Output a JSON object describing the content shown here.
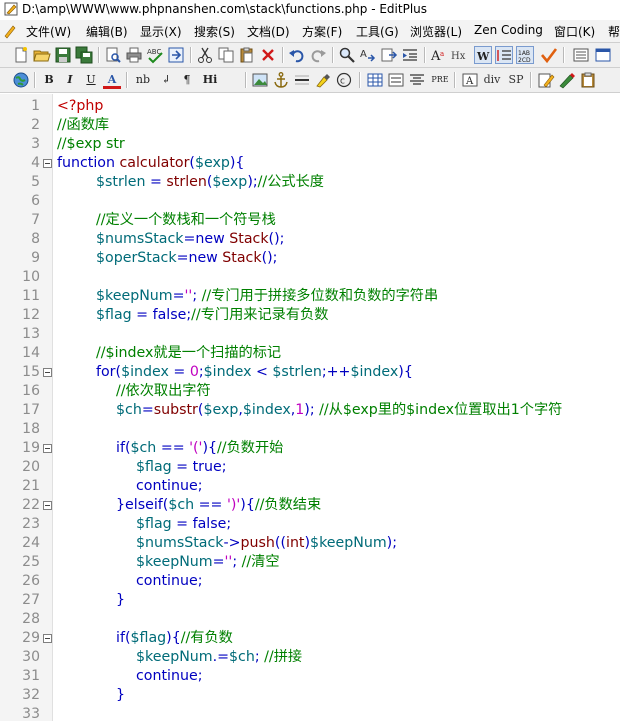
{
  "window": {
    "title": "D:\\amp\\WWW\\www.phpnanshen.com\\stack\\functions.php - EditPlus"
  },
  "menu": [
    {
      "label": "文件(W)"
    },
    {
      "label": "编辑(B)"
    },
    {
      "label": "显示(X)"
    },
    {
      "label": "搜索(S)"
    },
    {
      "label": "文档(D)"
    },
    {
      "label": "方案(F)"
    },
    {
      "label": "工具(G)"
    },
    {
      "label": "浏览器(L)"
    },
    {
      "label": "Zen Coding"
    },
    {
      "label": "窗口(K)"
    },
    {
      "label": "帮"
    }
  ],
  "toolbar1": {
    "icons": [
      "new-file-icon",
      "open-folder-icon",
      "save-icon",
      "save-all-icon",
      "print-preview-icon",
      "print-icon",
      "spell-check-icon",
      "browser-preview-icon",
      "cut-icon",
      "copy-icon",
      "paste-icon",
      "delete-icon",
      "undo-icon",
      "redo-icon",
      "find-icon",
      "replace-icon",
      "goto-icon",
      "indent-icon",
      "font-icon",
      "hex-icon",
      "word-wrap-icon",
      "line-number-icon",
      "column-icon",
      "check-icon",
      "settings-icon",
      "window-icon"
    ]
  },
  "toolbar2": {
    "labels": {
      "bold": "B",
      "italic": "I",
      "underline": "U",
      "font_color": "A",
      "nbsp": "nb",
      "br": "↲",
      "para": "¶",
      "heading": "Hi",
      "pre": "PRE",
      "div": "div",
      "span": "SP"
    },
    "icons": [
      "globe-icon",
      "image-icon",
      "anchor-icon",
      "hr-icon",
      "highlight-icon",
      "copyright-icon",
      "table-icon",
      "form-icon",
      "center-icon",
      "textbox-icon",
      "edit-icon",
      "pen-icon",
      "clipboard-icon"
    ]
  },
  "editor": {
    "lines": [
      {
        "n": "1",
        "indent": 0,
        "fold": false,
        "tokens": [
          {
            "t": "tag",
            "v": "<?php"
          }
        ]
      },
      {
        "n": "2",
        "indent": 0,
        "fold": false,
        "tokens": [
          {
            "t": "com",
            "v": "//函数库"
          }
        ]
      },
      {
        "n": "3",
        "indent": 0,
        "fold": false,
        "tokens": [
          {
            "t": "com",
            "v": "//$exp str"
          }
        ]
      },
      {
        "n": "4",
        "indent": 0,
        "fold": true,
        "tokens": [
          {
            "t": "kw",
            "v": "function "
          },
          {
            "t": "fn",
            "v": "calculator"
          },
          {
            "t": "op",
            "v": "("
          },
          {
            "t": "var",
            "v": "$exp"
          },
          {
            "t": "op",
            "v": "){"
          }
        ]
      },
      {
        "n": "5",
        "indent": 1,
        "fold": false,
        "tokens": [
          {
            "t": "var",
            "v": "$strlen"
          },
          {
            "t": "op",
            "v": " = "
          },
          {
            "t": "fn",
            "v": "strlen"
          },
          {
            "t": "op",
            "v": "("
          },
          {
            "t": "var",
            "v": "$exp"
          },
          {
            "t": "op",
            "v": ");"
          },
          {
            "t": "com",
            "v": "//公式长度"
          }
        ]
      },
      {
        "n": "6",
        "indent": 0,
        "fold": false,
        "tokens": []
      },
      {
        "n": "7",
        "indent": 1,
        "fold": false,
        "tokens": [
          {
            "t": "com",
            "v": "//定义一个数栈和一个符号栈"
          }
        ]
      },
      {
        "n": "8",
        "indent": 1,
        "fold": false,
        "tokens": [
          {
            "t": "var",
            "v": "$numsStack"
          },
          {
            "t": "op",
            "v": "="
          },
          {
            "t": "kw",
            "v": "new "
          },
          {
            "t": "fn",
            "v": "Stack"
          },
          {
            "t": "op",
            "v": "();"
          }
        ]
      },
      {
        "n": "9",
        "indent": 1,
        "fold": false,
        "tokens": [
          {
            "t": "var",
            "v": "$operStack"
          },
          {
            "t": "op",
            "v": "="
          },
          {
            "t": "kw",
            "v": "new "
          },
          {
            "t": "fn",
            "v": "Stack"
          },
          {
            "t": "op",
            "v": "();"
          }
        ]
      },
      {
        "n": "10",
        "indent": 0,
        "fold": false,
        "tokens": []
      },
      {
        "n": "11",
        "indent": 1,
        "fold": false,
        "tokens": [
          {
            "t": "var",
            "v": "$keepNum"
          },
          {
            "t": "op",
            "v": "="
          },
          {
            "t": "str",
            "v": "''"
          },
          {
            "t": "op",
            "v": "; "
          },
          {
            "t": "com",
            "v": "//专门用于拼接多位数和负数的字符串"
          }
        ]
      },
      {
        "n": "12",
        "indent": 1,
        "fold": false,
        "tokens": [
          {
            "t": "var",
            "v": "$flag"
          },
          {
            "t": "op",
            "v": " = "
          },
          {
            "t": "kw",
            "v": "false"
          },
          {
            "t": "op",
            "v": ";"
          },
          {
            "t": "com",
            "v": "//专门用来记录有负数"
          }
        ]
      },
      {
        "n": "13",
        "indent": 0,
        "fold": false,
        "tokens": []
      },
      {
        "n": "14",
        "indent": 1,
        "fold": false,
        "tokens": [
          {
            "t": "com",
            "v": "//$index就是一个扫描的标记"
          }
        ]
      },
      {
        "n": "15",
        "indent": 1,
        "fold": true,
        "tokens": [
          {
            "t": "kw",
            "v": "for"
          },
          {
            "t": "op",
            "v": "("
          },
          {
            "t": "var",
            "v": "$index"
          },
          {
            "t": "op",
            "v": " = "
          },
          {
            "t": "num",
            "v": "0"
          },
          {
            "t": "op",
            "v": ";"
          },
          {
            "t": "var",
            "v": "$index"
          },
          {
            "t": "op",
            "v": " < "
          },
          {
            "t": "var",
            "v": "$strlen"
          },
          {
            "t": "op",
            "v": ";++"
          },
          {
            "t": "var",
            "v": "$index"
          },
          {
            "t": "op",
            "v": "){"
          }
        ]
      },
      {
        "n": "16",
        "indent": 2,
        "fold": false,
        "tokens": [
          {
            "t": "com",
            "v": "//依次取出字符"
          }
        ]
      },
      {
        "n": "17",
        "indent": 2,
        "fold": false,
        "tokens": [
          {
            "t": "var",
            "v": "$ch"
          },
          {
            "t": "op",
            "v": "="
          },
          {
            "t": "fn",
            "v": "substr"
          },
          {
            "t": "op",
            "v": "("
          },
          {
            "t": "var",
            "v": "$exp"
          },
          {
            "t": "op",
            "v": ","
          },
          {
            "t": "var",
            "v": "$index"
          },
          {
            "t": "op",
            "v": ","
          },
          {
            "t": "num",
            "v": "1"
          },
          {
            "t": "op",
            "v": "); "
          },
          {
            "t": "com",
            "v": "//从$exp里的$index位置取出1个字符"
          }
        ]
      },
      {
        "n": "18",
        "indent": 0,
        "fold": false,
        "tokens": []
      },
      {
        "n": "19",
        "indent": 2,
        "fold": true,
        "tokens": [
          {
            "t": "kw",
            "v": "if"
          },
          {
            "t": "op",
            "v": "("
          },
          {
            "t": "var",
            "v": "$ch"
          },
          {
            "t": "op",
            "v": " == "
          },
          {
            "t": "str",
            "v": "'('"
          },
          {
            "t": "op",
            "v": "){"
          },
          {
            "t": "com",
            "v": "//负数开始"
          }
        ]
      },
      {
        "n": "20",
        "indent": 3,
        "fold": false,
        "tokens": [
          {
            "t": "var",
            "v": "$flag"
          },
          {
            "t": "op",
            "v": " = "
          },
          {
            "t": "kw",
            "v": "true"
          },
          {
            "t": "op",
            "v": ";"
          }
        ]
      },
      {
        "n": "21",
        "indent": 3,
        "fold": false,
        "tokens": [
          {
            "t": "kw",
            "v": "continue"
          },
          {
            "t": "op",
            "v": ";"
          }
        ]
      },
      {
        "n": "22",
        "indent": 2,
        "fold": true,
        "tokens": [
          {
            "t": "op",
            "v": "}"
          },
          {
            "t": "kw",
            "v": "elseif"
          },
          {
            "t": "op",
            "v": "("
          },
          {
            "t": "var",
            "v": "$ch"
          },
          {
            "t": "op",
            "v": " == "
          },
          {
            "t": "str",
            "v": "')'"
          },
          {
            "t": "op",
            "v": "){"
          },
          {
            "t": "com",
            "v": "//负数结束"
          }
        ]
      },
      {
        "n": "23",
        "indent": 3,
        "fold": false,
        "tokens": [
          {
            "t": "var",
            "v": "$flag"
          },
          {
            "t": "op",
            "v": " = "
          },
          {
            "t": "kw",
            "v": "false"
          },
          {
            "t": "op",
            "v": ";"
          }
        ]
      },
      {
        "n": "24",
        "indent": 3,
        "fold": false,
        "tokens": [
          {
            "t": "var",
            "v": "$numsStack"
          },
          {
            "t": "op",
            "v": "->"
          },
          {
            "t": "fn",
            "v": "push"
          },
          {
            "t": "op",
            "v": "(("
          },
          {
            "t": "fn",
            "v": "int"
          },
          {
            "t": "op",
            "v": ")"
          },
          {
            "t": "var",
            "v": "$keepNum"
          },
          {
            "t": "op",
            "v": ");"
          }
        ]
      },
      {
        "n": "25",
        "indent": 3,
        "fold": false,
        "tokens": [
          {
            "t": "var",
            "v": "$keepNum"
          },
          {
            "t": "op",
            "v": "="
          },
          {
            "t": "str",
            "v": "''"
          },
          {
            "t": "op",
            "v": "; "
          },
          {
            "t": "com",
            "v": "//清空"
          }
        ]
      },
      {
        "n": "26",
        "indent": 3,
        "fold": false,
        "tokens": [
          {
            "t": "kw",
            "v": "continue"
          },
          {
            "t": "op",
            "v": ";"
          }
        ]
      },
      {
        "n": "27",
        "indent": 2,
        "fold": false,
        "tokens": [
          {
            "t": "op",
            "v": "}"
          }
        ]
      },
      {
        "n": "28",
        "indent": 0,
        "fold": false,
        "tokens": []
      },
      {
        "n": "29",
        "indent": 2,
        "fold": true,
        "tokens": [
          {
            "t": "kw",
            "v": "if"
          },
          {
            "t": "op",
            "v": "("
          },
          {
            "t": "var",
            "v": "$flag"
          },
          {
            "t": "op",
            "v": "){"
          },
          {
            "t": "com",
            "v": "//有负数"
          }
        ]
      },
      {
        "n": "30",
        "indent": 3,
        "fold": false,
        "tokens": [
          {
            "t": "var",
            "v": "$keepNum"
          },
          {
            "t": "op",
            "v": ".="
          },
          {
            "t": "var",
            "v": "$ch"
          },
          {
            "t": "op",
            "v": "; "
          },
          {
            "t": "com",
            "v": "//拼接"
          }
        ]
      },
      {
        "n": "31",
        "indent": 3,
        "fold": false,
        "tokens": [
          {
            "t": "kw",
            "v": "continue"
          },
          {
            "t": "op",
            "v": ";"
          }
        ]
      },
      {
        "n": "32",
        "indent": 2,
        "fold": false,
        "tokens": [
          {
            "t": "op",
            "v": "}"
          }
        ]
      },
      {
        "n": "33",
        "indent": 0,
        "fold": false,
        "tokens": []
      }
    ]
  }
}
